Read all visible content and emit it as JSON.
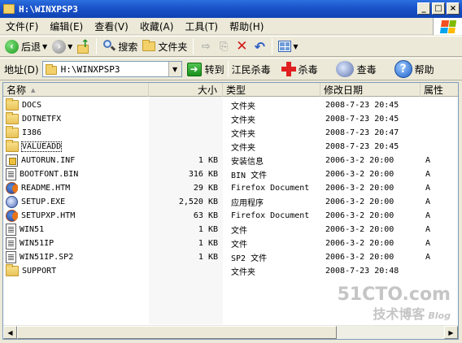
{
  "window": {
    "title": "H:\\WINXPSP3",
    "buttons": {
      "minimize": "_",
      "maximize": "□",
      "close": "×"
    }
  },
  "menu": [
    "文件(F)",
    "编辑(E)",
    "查看(V)",
    "收藏(A)",
    "工具(T)",
    "帮助(H)"
  ],
  "toolbar": {
    "back": "后退",
    "search": "搜索",
    "folders": "文件夹"
  },
  "address": {
    "label": "地址(D)",
    "value": "H:\\WINXPSP3",
    "go": "转到",
    "plugin1": "江民杀毒",
    "plugin2": "杀毒",
    "plugin3": "查毒",
    "help": "帮助"
  },
  "columns": {
    "name": "名称",
    "size": "大小",
    "type": "类型",
    "date": "修改日期",
    "attr": "属性"
  },
  "files": [
    {
      "name": "DOCS",
      "size": "",
      "type": "文件夹",
      "date": "2008-7-23 20:45",
      "attr": "",
      "icon": "folder"
    },
    {
      "name": "DOTNETFX",
      "size": "",
      "type": "文件夹",
      "date": "2008-7-23 20:45",
      "attr": "",
      "icon": "folder"
    },
    {
      "name": "I386",
      "size": "",
      "type": "文件夹",
      "date": "2008-7-23 20:47",
      "attr": "",
      "icon": "folder"
    },
    {
      "name": "VALUEADD",
      "size": "",
      "type": "文件夹",
      "date": "2008-7-23 20:45",
      "attr": "",
      "icon": "folder"
    },
    {
      "name": "AUTORUN.INF",
      "size": "1 KB",
      "type": "安装信息",
      "date": "2006-3-2 20:00",
      "attr": "A",
      "icon": "inf"
    },
    {
      "name": "BOOTFONT.BIN",
      "size": "316 KB",
      "type": "BIN 文件",
      "date": "2006-3-2 20:00",
      "attr": "A",
      "icon": "doc"
    },
    {
      "name": "README.HTM",
      "size": "29 KB",
      "type": "Firefox Document",
      "date": "2006-3-2 20:00",
      "attr": "A",
      "icon": "firefox"
    },
    {
      "name": "SETUP.EXE",
      "size": "2,520 KB",
      "type": "应用程序",
      "date": "2006-3-2 20:00",
      "attr": "A",
      "icon": "exe"
    },
    {
      "name": "SETUPXP.HTM",
      "size": "63 KB",
      "type": "Firefox Document",
      "date": "2006-3-2 20:00",
      "attr": "A",
      "icon": "firefox"
    },
    {
      "name": "WIN51",
      "size": "1 KB",
      "type": "文件",
      "date": "2006-3-2 20:00",
      "attr": "A",
      "icon": "doc"
    },
    {
      "name": "WIN51IP",
      "size": "1 KB",
      "type": "文件",
      "date": "2006-3-2 20:00",
      "attr": "A",
      "icon": "doc"
    },
    {
      "name": "WIN51IP.SP2",
      "size": "1 KB",
      "type": "SP2 文件",
      "date": "2006-3-2 20:00",
      "attr": "A",
      "icon": "doc"
    },
    {
      "name": "SUPPORT",
      "size": "",
      "type": "文件夹",
      "date": "2008-7-23 20:48",
      "attr": "",
      "icon": "folder"
    }
  ],
  "watermark": {
    "line1": "51CTO.com",
    "line2": "技术博客",
    "line3": "Blog"
  }
}
